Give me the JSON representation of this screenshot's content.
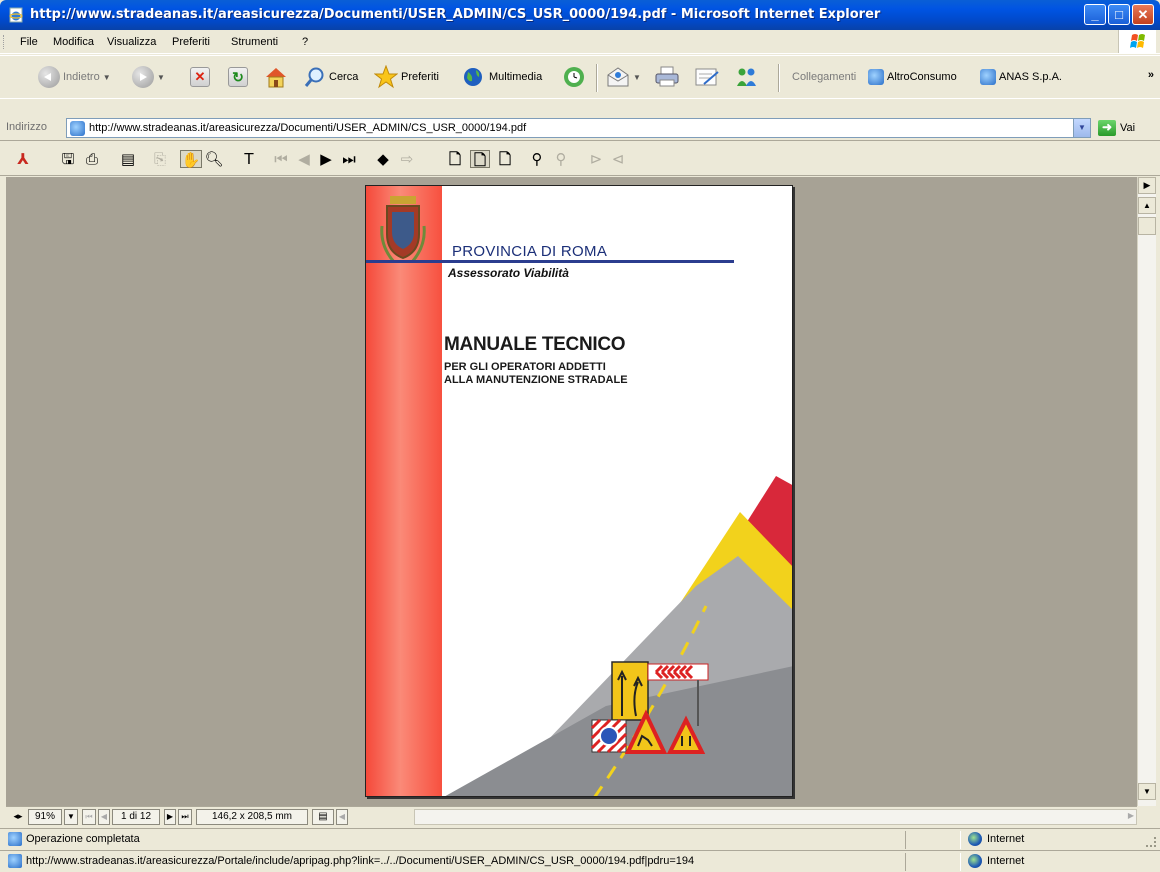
{
  "window": {
    "title": "http://www.stradeanas.it/areasicurezza/Documenti/USER_ADMIN/CS_USR_0000/194.pdf - Microsoft Internet Explorer",
    "controls": [
      "minimize",
      "maximize",
      "close"
    ]
  },
  "menubar": {
    "items": [
      "File",
      "Modifica",
      "Visualizza",
      "Preferiti",
      "Strumenti",
      "?"
    ]
  },
  "toolbar": {
    "back_label": "Indietro",
    "search_label": "Cerca",
    "favorites_label": "Preferiti",
    "media_label": "Multimedia",
    "links_label": "Collegamenti",
    "link1_label": "AltroConsumo",
    "link2_label": "ANAS S.p.A.",
    "more_glyph": "»"
  },
  "address": {
    "label": "Indirizzo",
    "url": "http://www.stradeanas.it/areasicurezza/Documenti/USER_ADMIN/CS_USR_0000/194.pdf",
    "go_label": "Vai"
  },
  "reader": {
    "zoom": "91%",
    "page_indicator": "1 di 12",
    "page_size": "146,2 x 208,5 mm"
  },
  "document": {
    "org": "PROVINCIA DI ROMA",
    "department": "Assessorato Viabilità",
    "title": "MANUALE TECNICO",
    "subtitle_line1": "PER GLI OPERATORI ADDETTI",
    "subtitle_line2": "ALLA MANUTENZIONE STRADALE"
  },
  "status": {
    "text": "Operazione completata",
    "zone": "Internet"
  },
  "status2": {
    "text": "http://www.stradeanas.it/areasicurezza/Portale/include/apripag.php?link=../../Documenti/USER_ADMIN/CS_USR_0000/194.pdf|pdru=194",
    "zone": "Internet"
  },
  "colors": {
    "titlebar": "#0054e3",
    "chrome": "#ece9d8",
    "doc_background": "#a7a295",
    "cover_red": "#f5493a",
    "cover_blue": "#2b3d8f"
  }
}
